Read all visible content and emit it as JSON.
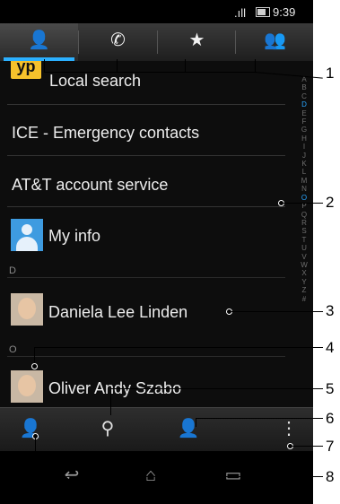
{
  "status_bar": {
    "time": "9:39 am"
  },
  "tabs": [
    {
      "icon": "contacts-icon",
      "glyph": "👤"
    },
    {
      "icon": "phone-icon",
      "glyph": "✆"
    },
    {
      "icon": "star-icon",
      "glyph": "★"
    },
    {
      "icon": "groups-icon",
      "glyph": "👥"
    }
  ],
  "list": {
    "local_search": {
      "logo": "yp",
      "label": "Local search"
    },
    "ice": "ICE - Emergency contacts",
    "att": "AT&T account service",
    "my_info": "My info",
    "section_d": "D",
    "daniela": "Daniela Lee Linden",
    "section_o": "O",
    "oliver": "Oliver Andy Szabo"
  },
  "alphabet": [
    "A",
    "B",
    "C",
    "D",
    "E",
    "F",
    "G",
    "H",
    "I",
    "J",
    "K",
    "L",
    "M",
    "N",
    "O",
    "P",
    "Q",
    "R",
    "S",
    "T",
    "U",
    "V",
    "W",
    "X",
    "Y",
    "Z",
    "#"
  ],
  "toolbar": [
    {
      "icon": "favorites-filter-icon",
      "glyph": "👤"
    },
    {
      "icon": "search-icon",
      "glyph": "⚲"
    },
    {
      "icon": "add-contact-icon",
      "glyph": "👤"
    },
    {
      "icon": "menu-icon",
      "glyph": "⋮"
    }
  ],
  "nav": [
    {
      "icon": "back-icon",
      "glyph": "↩"
    },
    {
      "icon": "home-icon",
      "glyph": "⌂"
    },
    {
      "icon": "recent-apps-icon",
      "glyph": "▭"
    }
  ],
  "callouts": [
    "1",
    "2",
    "3",
    "4",
    "5",
    "6",
    "7",
    "8"
  ],
  "colors": {
    "accent": "#2bb0ff",
    "background": "#0d0d0d",
    "yp_yellow": "#f6c22c"
  }
}
